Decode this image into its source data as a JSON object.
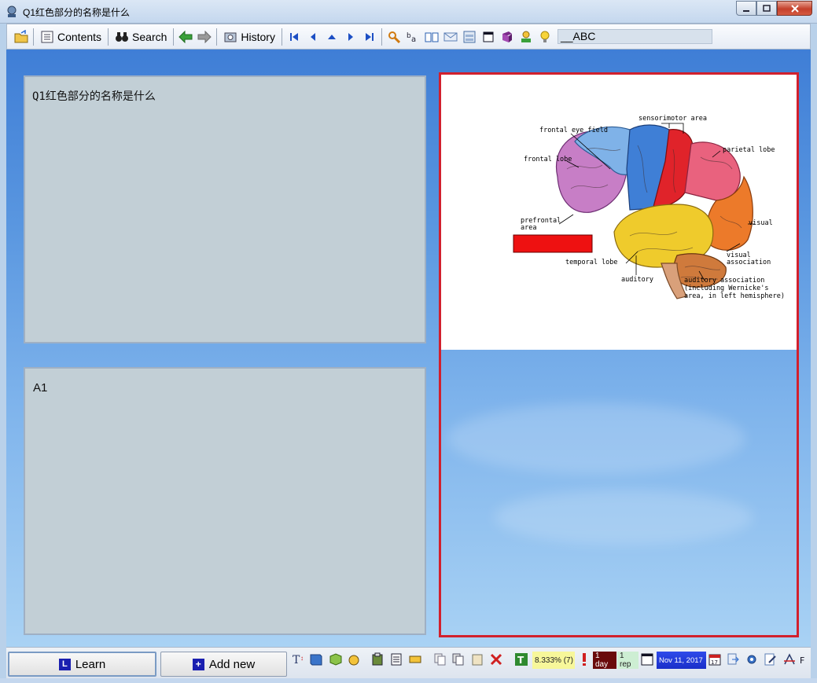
{
  "window": {
    "title": "Q1红色部分的名称是什么",
    "controls": [
      "minimize",
      "maximize",
      "close"
    ]
  },
  "toolbar": {
    "contents_label": "Contents",
    "search_label": "Search",
    "history_label": "History",
    "field_value": "__ABC",
    "icons": [
      "open-folder-icon",
      "contents-icon",
      "binoculars-icon",
      "back-arrow-icon",
      "forward-arrow-icon",
      "history-icon",
      "first-icon",
      "previous-icon",
      "up-icon",
      "next-icon",
      "last-icon",
      "find-icon",
      "font-icon",
      "book-icon",
      "mail-icon",
      "window-icon",
      "restore-icon",
      "books-icon",
      "user-icon",
      "bulb-icon"
    ]
  },
  "question": {
    "text": "Q1红色部分的名称是什么"
  },
  "answer": {
    "text": "A1"
  },
  "image": {
    "labels": {
      "sensorimotor": "sensorimotor area",
      "frontal_eye": "frontal eye field",
      "parietal": "parietal lobe",
      "frontal": "frontal lobe",
      "prefrontal_1": "prefrontal",
      "prefrontal_2": "area",
      "visual": "visual",
      "visual_assoc_1": "visual",
      "visual_assoc_2": "association",
      "temporal": "temporal lobe",
      "auditory": "auditory",
      "auditory_assoc_1": "auditory association",
      "auditory_assoc_2": "(including Wernicke's",
      "auditory_assoc_3": "area, in left hemisphere)"
    },
    "highlight_color": "#ee1111",
    "border_color": "#d2202d"
  },
  "bottombar": {
    "learn_label": "Learn",
    "learn_key": "L",
    "add_label": "Add new",
    "add_key": "+",
    "percent": "8.333%",
    "count": "(7)",
    "interval": "1 day",
    "reps": "1 rep",
    "date": "Nov 11, 2017",
    "calendar_day": "17"
  }
}
